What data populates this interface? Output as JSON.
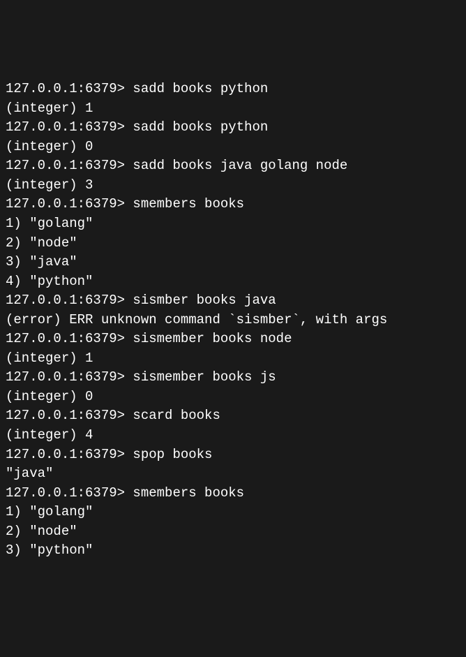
{
  "terminal": {
    "prompt": "127.0.0.1:6379>",
    "lines": [
      {
        "type": "cmd",
        "prompt": "127.0.0.1:6379>",
        "text": " sadd books python"
      },
      {
        "type": "out",
        "text": "(integer) 1"
      },
      {
        "type": "cmd",
        "prompt": "127.0.0.1:6379>",
        "text": " sadd books python"
      },
      {
        "type": "out",
        "text": "(integer) 0"
      },
      {
        "type": "cmd",
        "prompt": "127.0.0.1:6379>",
        "text": " sadd books java golang node"
      },
      {
        "type": "out",
        "text": "(integer) 3"
      },
      {
        "type": "cmd",
        "prompt": "127.0.0.1:6379>",
        "text": " smembers books"
      },
      {
        "type": "out",
        "text": "1) \"golang\""
      },
      {
        "type": "out",
        "text": "2) \"node\""
      },
      {
        "type": "out",
        "text": "3) \"java\""
      },
      {
        "type": "out",
        "text": "4) \"python\""
      },
      {
        "type": "cmd",
        "prompt": "127.0.0.1:6379>",
        "text": " sismber books java"
      },
      {
        "type": "out",
        "text": "(error) ERR unknown command `sismber`, with args"
      },
      {
        "type": "cmd",
        "prompt": "127.0.0.1:6379>",
        "text": " sismember books node"
      },
      {
        "type": "out",
        "text": "(integer) 1"
      },
      {
        "type": "cmd",
        "prompt": "127.0.0.1:6379>",
        "text": " sismember books js"
      },
      {
        "type": "out",
        "text": "(integer) 0"
      },
      {
        "type": "cmd",
        "prompt": "127.0.0.1:6379>",
        "text": " scard books"
      },
      {
        "type": "out",
        "text": "(integer) 4"
      },
      {
        "type": "cmd",
        "prompt": "127.0.0.1:6379>",
        "text": " spop books"
      },
      {
        "type": "out",
        "text": "\"java\""
      },
      {
        "type": "cmd",
        "prompt": "127.0.0.1:6379>",
        "text": " smembers books"
      },
      {
        "type": "out",
        "text": "1) \"golang\""
      },
      {
        "type": "out",
        "text": "2) \"node\""
      },
      {
        "type": "out",
        "text": "3) \"python\""
      }
    ]
  }
}
